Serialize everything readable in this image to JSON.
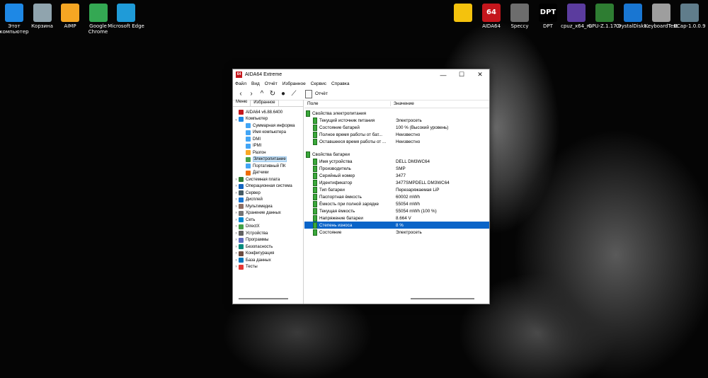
{
  "desktop": {
    "icons_left": [
      {
        "label": "Этот компьютер",
        "icon": "monitor-icon",
        "color": "#1e88e5"
      },
      {
        "label": "Корзина",
        "icon": "recycle-bin-icon",
        "color": "#90a4ae"
      },
      {
        "label": "AIMP",
        "icon": "aimp-icon",
        "color": "#f5a623"
      },
      {
        "label": "Google Chrome",
        "icon": "chrome-icon",
        "color": "#34a853"
      },
      {
        "label": "Microsoft Edge",
        "icon": "edge-icon",
        "color": "#1f9bd8"
      }
    ],
    "icons_right": [
      {
        "label": "",
        "icon": "warning-icon",
        "color": "#f4c20d"
      },
      {
        "label": "AIDA64",
        "icon": "aida64-icon",
        "color": "#c4161c",
        "glyph": "64"
      },
      {
        "label": "Speccy",
        "icon": "speccy-icon",
        "color": "#6d6d6d"
      },
      {
        "label": "DPT",
        "icon": "dpt-icon",
        "color": "#000000",
        "glyph": "DPT"
      },
      {
        "label": "cpuz_x64_ru",
        "icon": "cpuz-icon",
        "color": "#5b3c9e"
      },
      {
        "label": "GPU-Z.1.17.0",
        "icon": "gpuz-icon",
        "color": "#2e7d32"
      },
      {
        "label": "CrystalDiskI...",
        "icon": "crystaldisk-icon",
        "color": "#1976d2"
      },
      {
        "label": "KeyboardTest",
        "icon": "keyboard-icon",
        "color": "#9e9e9e"
      },
      {
        "label": "ECap-1.0.0.9",
        "icon": "camera-icon",
        "color": "#607d8b"
      }
    ]
  },
  "window": {
    "title": "AIDA64 Extreme",
    "menu": [
      "Файл",
      "Вид",
      "Отчёт",
      "Избранное",
      "Сервис",
      "Справка"
    ],
    "report_label": "Отчёт",
    "tabs": [
      "Меню",
      "Избранное"
    ],
    "tree": [
      {
        "label": "AIDA64 v6.88.6400",
        "level": 0,
        "exp": "",
        "color": "#c4161c"
      },
      {
        "label": "Компьютер",
        "level": 0,
        "exp": "⌄",
        "color": "#1e88e5"
      },
      {
        "label": "Суммарная информа",
        "level": 1,
        "exp": "",
        "color": "#42a5f5"
      },
      {
        "label": "Имя компьютера",
        "level": 1,
        "exp": "",
        "color": "#42a5f5"
      },
      {
        "label": "DMI",
        "level": 1,
        "exp": "",
        "color": "#42a5f5"
      },
      {
        "label": "IPMI",
        "level": 1,
        "exp": "",
        "color": "#42a5f5"
      },
      {
        "label": "Разгон",
        "level": 1,
        "exp": "",
        "color": "#f9a825"
      },
      {
        "label": "Электропитание",
        "level": 1,
        "exp": "",
        "color": "#43a047",
        "selected": true
      },
      {
        "label": "Портативный ПК",
        "level": 1,
        "exp": "",
        "color": "#42a5f5"
      },
      {
        "label": "Датчики",
        "level": 1,
        "exp": "",
        "color": "#ef6c00"
      },
      {
        "label": "Системная плата",
        "level": 0,
        "exp": "›",
        "color": "#2e7d32"
      },
      {
        "label": "Операционная система",
        "level": 0,
        "exp": "›",
        "color": "#1565c0"
      },
      {
        "label": "Сервер",
        "level": 0,
        "exp": "›",
        "color": "#455a64"
      },
      {
        "label": "Дисплей",
        "level": 0,
        "exp": "›",
        "color": "#1976d2"
      },
      {
        "label": "Мультимедиа",
        "level": 0,
        "exp": "›",
        "color": "#8d6e63"
      },
      {
        "label": "Хранение данных",
        "level": 0,
        "exp": "›",
        "color": "#757575"
      },
      {
        "label": "Сеть",
        "level": 0,
        "exp": "›",
        "color": "#0288d1"
      },
      {
        "label": "DirectX",
        "level": 0,
        "exp": "›",
        "color": "#43a047"
      },
      {
        "label": "Устройства",
        "level": 0,
        "exp": "›",
        "color": "#616161"
      },
      {
        "label": "Программы",
        "level": 0,
        "exp": "›",
        "color": "#5c6bc0"
      },
      {
        "label": "Безопасность",
        "level": 0,
        "exp": "›",
        "color": "#00897b"
      },
      {
        "label": "Конфигурация",
        "level": 0,
        "exp": "›",
        "color": "#6d4c41"
      },
      {
        "label": "База данных",
        "level": 0,
        "exp": "›",
        "color": "#0277bd"
      },
      {
        "label": "Тесты",
        "level": 0,
        "exp": "›",
        "color": "#e53935"
      }
    ],
    "columns": {
      "field": "Поле",
      "value": "Значение"
    },
    "sections": [
      {
        "title": "Свойства электропитания",
        "rows": [
          {
            "field": "Текущий источник питания",
            "value": "Электросеть"
          },
          {
            "field": "Состояние батарей",
            "value": "100 % (Высокий уровень)"
          },
          {
            "field": "Полное время работы от бат...",
            "value": "Неизвестно"
          },
          {
            "field": "Оставшееся время работы от ...",
            "value": "Неизвестно"
          }
        ]
      },
      {
        "title": "Свойства батареи",
        "rows": [
          {
            "field": "Имя устройства",
            "value": "DELL DM3WC64"
          },
          {
            "field": "Производитель",
            "value": "SMP"
          },
          {
            "field": "Серийный номер",
            "value": "3477"
          },
          {
            "field": "Идентификатор",
            "value": "3477SMPDELL DM3WC64"
          },
          {
            "field": "Тип батареи",
            "value": "Перезаряжаемая LiP"
          },
          {
            "field": "Паспортная ёмкость",
            "value": "60002 mWh"
          },
          {
            "field": "Ёмкость при полной зарядке",
            "value": "55054 mWh"
          },
          {
            "field": "Текущая ёмкость",
            "value": "55054 mWh  (100 %)"
          },
          {
            "field": "Напряжение батареи",
            "value": "8.664 V"
          },
          {
            "field": "Степень износа",
            "value": "8 %",
            "selected": true
          },
          {
            "field": "Состояние",
            "value": "Электросеть"
          }
        ]
      }
    ]
  }
}
